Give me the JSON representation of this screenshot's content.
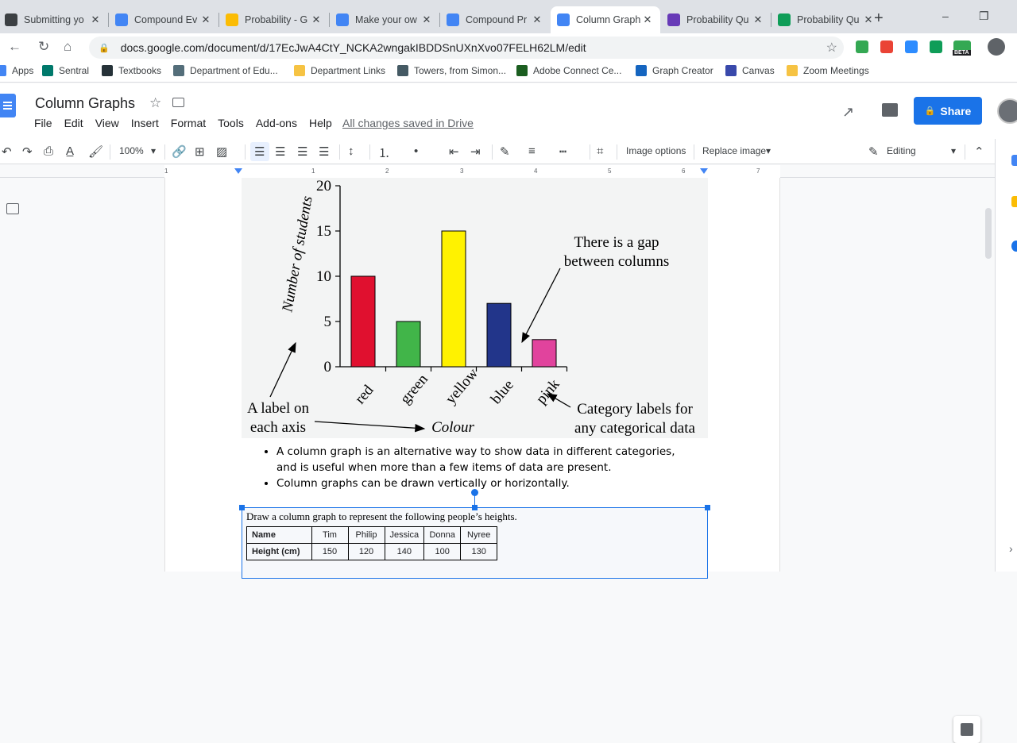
{
  "browser": {
    "tabs": [
      {
        "title": "Submitting yo",
        "color": "#3c4043",
        "active": false
      },
      {
        "title": "Compound Ev",
        "color": "#4285f4",
        "active": false
      },
      {
        "title": "Probability - G",
        "color": "#fbbc04",
        "active": false
      },
      {
        "title": "Make your ow",
        "color": "#4285f4",
        "active": false
      },
      {
        "title": "Compound Pr",
        "color": "#4285f4",
        "active": false
      },
      {
        "title": "Column Graph",
        "color": "#4285f4",
        "active": true
      },
      {
        "title": "Probability Qu",
        "color": "#673ab7",
        "active": false
      },
      {
        "title": "Probability Qu",
        "color": "#0f9d58",
        "active": false
      }
    ],
    "tab_close": "✕",
    "new_tab": "+",
    "url": "docs.google.com/document/d/17EcJwA4CtY_NCKA2wngakIBDDSnUXnXvo07FELH62LM/edit",
    "beta_badge": "BETA",
    "bookmarks": [
      {
        "label": "Apps",
        "color": "#4285f4"
      },
      {
        "label": "Sentral",
        "color": "#00796b"
      },
      {
        "label": "Textbooks",
        "color": "#263238"
      },
      {
        "label": "Department of Edu...",
        "color": "#546e7a"
      },
      {
        "label": "Department Links",
        "color": "#f6c343"
      },
      {
        "label": "Towers, from Simon...",
        "color": "#455a64"
      },
      {
        "label": "Adobe Connect Ce...",
        "color": "#1b5e20"
      },
      {
        "label": "Graph Creator",
        "color": "#1565c0"
      },
      {
        "label": "Canvas",
        "color": "#3949ab"
      },
      {
        "label": "Zoom Meetings",
        "color": "#f6c343"
      }
    ]
  },
  "doc": {
    "title": "Column Graphs",
    "menus": [
      "File",
      "Edit",
      "View",
      "Insert",
      "Format",
      "Tools",
      "Add-ons",
      "Help"
    ],
    "save_status": "All changes saved in Drive",
    "share_label": "Share",
    "share_icon": "lock-icon",
    "brand_color": "#1a73e8"
  },
  "toolbar": {
    "zoom": "100%",
    "image_options": "Image options",
    "replace_image": "Replace image",
    "mode": "Editing"
  },
  "ruler": {
    "numbers": [
      "1",
      "1",
      "2",
      "3",
      "4",
      "5",
      "6",
      "7"
    ]
  },
  "figure": {
    "annotation_gap": [
      "There is a gap",
      "between columns"
    ],
    "annotation_axis": [
      "A label on",
      "each axis"
    ],
    "annotation_category": [
      "Category labels for",
      "any categorical data"
    ]
  },
  "chart_data": {
    "type": "bar",
    "categories": [
      "red",
      "green",
      "yellow",
      "blue",
      "pink"
    ],
    "values": [
      10,
      5,
      15,
      7,
      3
    ],
    "colors": [
      "#e0102f",
      "#41b549",
      "#fff200",
      "#22358a",
      "#e1439d"
    ],
    "title": "",
    "xlabel": "Colour",
    "ylabel": "Number of students",
    "ylim": [
      0,
      20
    ],
    "yticks": [
      0,
      5,
      10,
      15,
      20
    ],
    "grid": false
  },
  "bullets": [
    "A column graph is an alternative way to show data in different categories, and is useful when more than a few items of data are present.",
    "Column graphs can be drawn vertically or horizontally."
  ],
  "question": {
    "prompt": "Draw a column graph to represent the following people’s heights.",
    "table": [
      [
        "Name",
        "Tim",
        "Philip",
        "Jessica",
        "Donna",
        "Nyree"
      ],
      [
        "Height (cm)",
        "150",
        "120",
        "140",
        "100",
        "130"
      ]
    ]
  }
}
